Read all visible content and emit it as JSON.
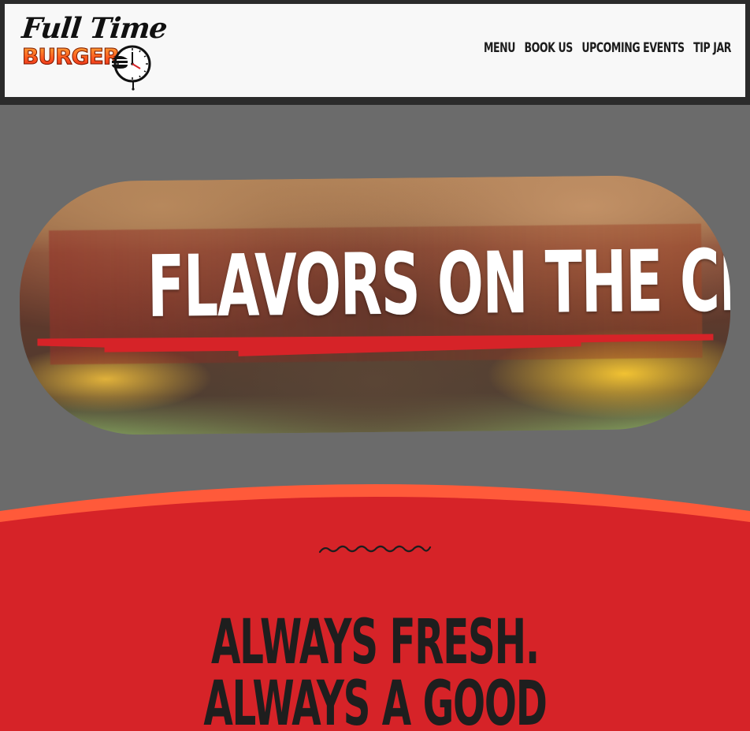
{
  "header": {
    "logo": {
      "line1": "Full Time",
      "line2": "BURGERS"
    },
    "nav": [
      {
        "label": "MENU"
      },
      {
        "label": "BOOK US"
      },
      {
        "label": "UPCOMING EVENTS"
      },
      {
        "label": "TIP JAR"
      }
    ]
  },
  "hero": {
    "title": "FLAVORS ON THE CLOCK"
  },
  "tagline": {
    "line1": "ALWAYS FRESH.",
    "line2": "ALWAYS A GOOD"
  },
  "colors": {
    "background_gray": "#6b6b6b",
    "header_bg": "#f8f8f8",
    "brand_red": "#d62328",
    "brand_orange": "#ff5a3a",
    "text_dark": "#1e1e1e"
  },
  "icons": [
    "clock-burger-icon",
    "squiggle-divider-icon"
  ]
}
